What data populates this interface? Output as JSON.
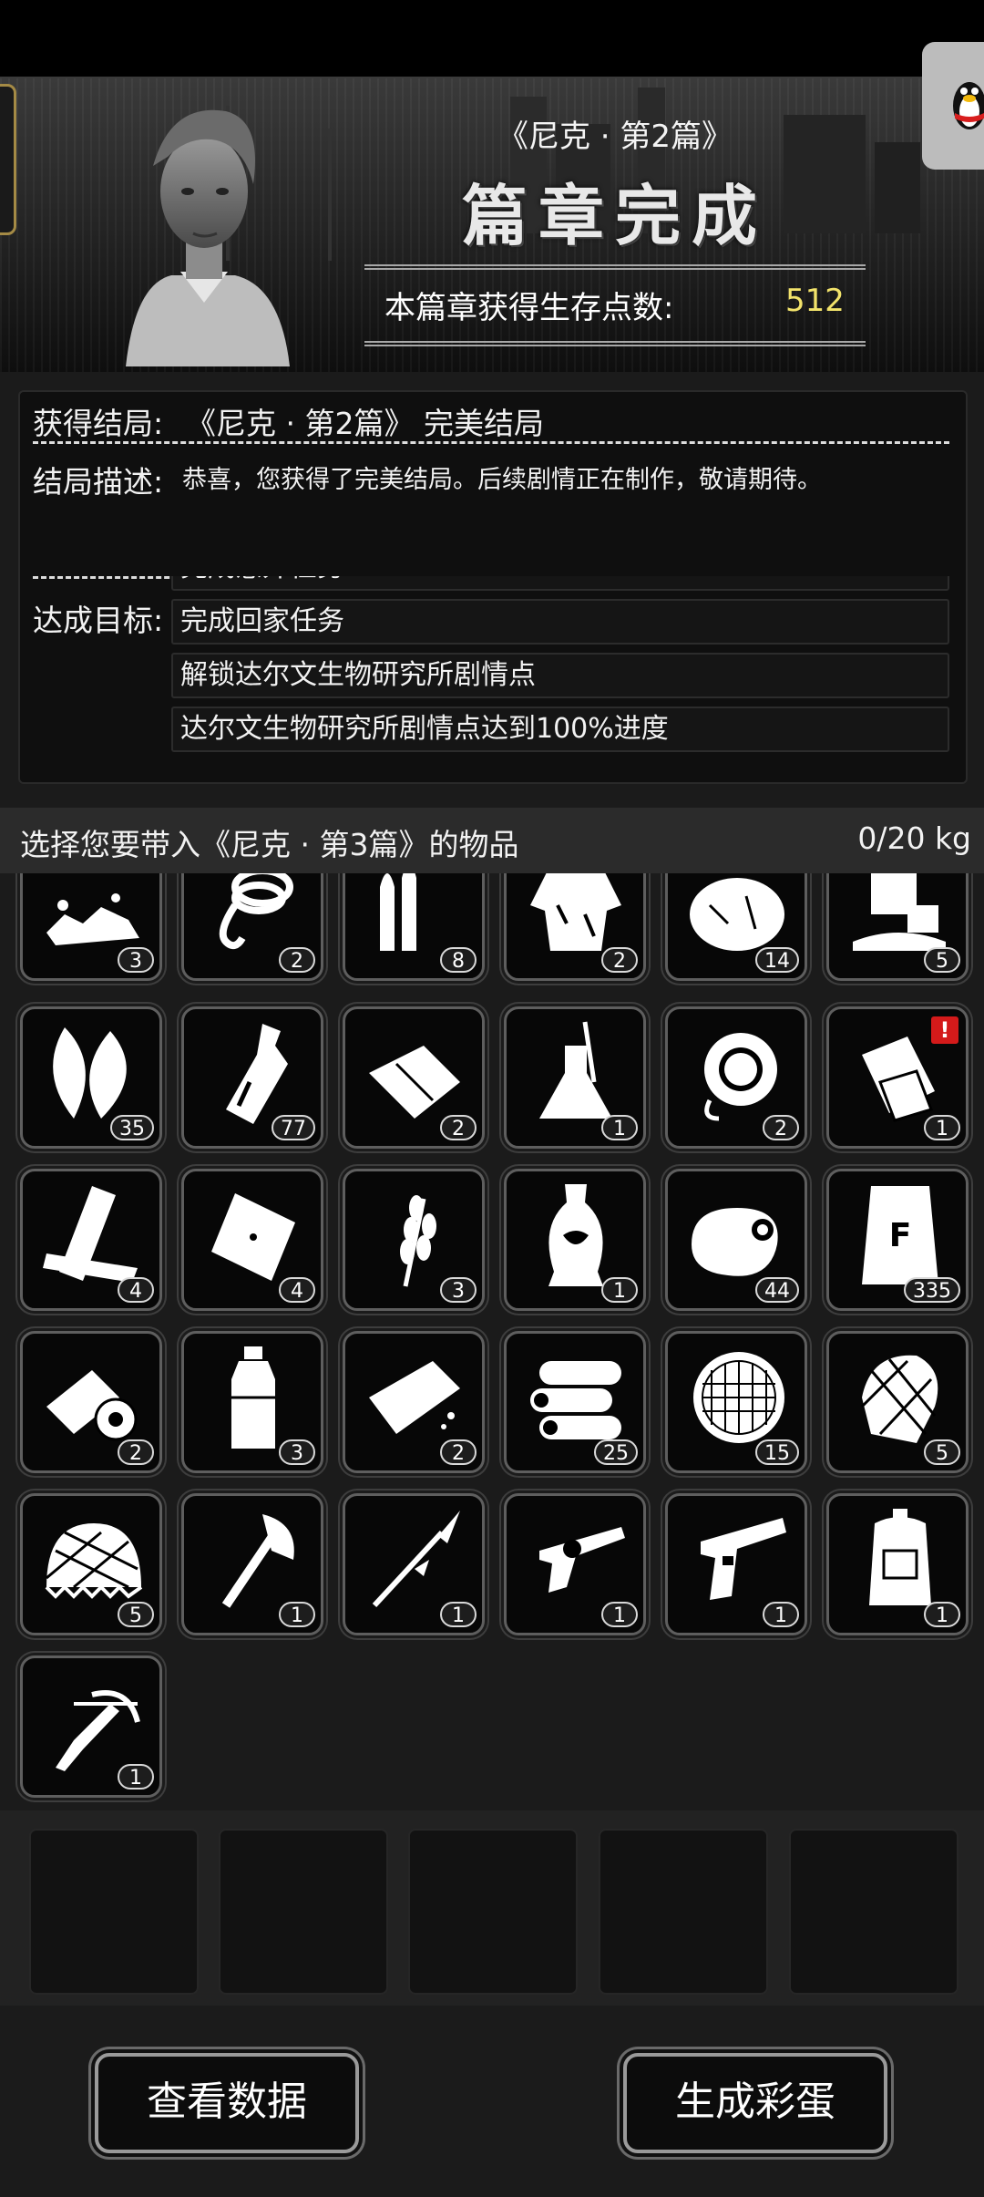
{
  "banner": {
    "chapter_title": "《尼克 · 第2篇》",
    "complete_title": "篇章完成",
    "points_label": "本篇章获得生存点数:",
    "points_value": "512",
    "points_color": "#f2e36b"
  },
  "summary": {
    "ending_label": "获得结局:",
    "ending_value": "《尼克 · 第2篇》 完美结局",
    "description_label": "结局描述:",
    "description_text": "恭喜，您获得了完美结局。后续剧情正在制作，敬请期待。",
    "goals_label": "达成目标:",
    "goals": [
      "完成意外任务",
      "完成回家任务",
      "解锁达尔文生物研究所剧情点",
      "达尔文生物研究所剧情点达到100%进度"
    ]
  },
  "selection": {
    "prompt": "选择您要带入《尼克 · 第3篇》的物品",
    "weight": "0/20 kg"
  },
  "items": [
    {
      "icon": "stones-icon",
      "count": "3"
    },
    {
      "icon": "rope-icon",
      "count": "2"
    },
    {
      "icon": "bullets-icon",
      "count": "8"
    },
    {
      "icon": "ragged-shirt-icon",
      "count": "2"
    },
    {
      "icon": "cotton-icon",
      "count": "14"
    },
    {
      "icon": "melting-ice-icon",
      "count": "5"
    },
    {
      "icon": "leaves-icon",
      "count": "35"
    },
    {
      "icon": "bottle-icon",
      "count": "77"
    },
    {
      "icon": "cloth-icon",
      "count": "2"
    },
    {
      "icon": "flask-icon",
      "count": "1"
    },
    {
      "icon": "gas-mask-icon",
      "count": "2"
    },
    {
      "icon": "documents-icon",
      "count": "1",
      "alert": "!"
    },
    {
      "icon": "planks-icon",
      "count": "4"
    },
    {
      "icon": "snack-bag-icon",
      "count": "4"
    },
    {
      "icon": "wheat-icon",
      "count": "3"
    },
    {
      "icon": "vase-icon",
      "count": "1"
    },
    {
      "icon": "raw-meat-icon",
      "count": "44"
    },
    {
      "icon": "flour-sack-icon",
      "count": "335",
      "label": "F"
    },
    {
      "icon": "bandage-icon",
      "count": "2"
    },
    {
      "icon": "water-bottle-icon",
      "count": "3"
    },
    {
      "icon": "soap-icon",
      "count": "2"
    },
    {
      "icon": "logs-icon",
      "count": "25"
    },
    {
      "icon": "filter-mesh-icon",
      "count": "15"
    },
    {
      "icon": "net-icon",
      "count": "5"
    },
    {
      "icon": "helmet-net-icon",
      "count": "5"
    },
    {
      "icon": "axe-icon",
      "count": "1"
    },
    {
      "icon": "spear-icon",
      "count": "1"
    },
    {
      "icon": "revolver-icon",
      "count": "1"
    },
    {
      "icon": "pistol-icon",
      "count": "1"
    },
    {
      "icon": "backpack-icon",
      "count": "1"
    },
    {
      "icon": "crossbow-icon",
      "count": "1"
    }
  ],
  "carry_slots": [
    "",
    "",
    "",
    "",
    ""
  ],
  "buttons": {
    "view_data": "查看数据",
    "generate_egg": "生成彩蛋"
  }
}
